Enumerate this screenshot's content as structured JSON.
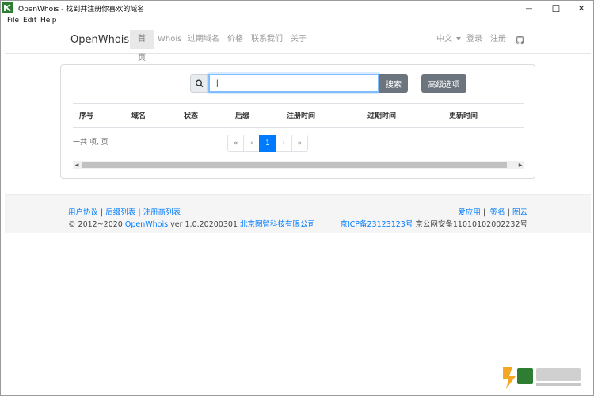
{
  "window": {
    "title": "OpenWhois - 找到并注册你喜欢的域名",
    "minimize_glyph": "—",
    "maximize_glyph": "☐",
    "close_glyph": "✕"
  },
  "menu": [
    "File",
    "Edit",
    "Help"
  ],
  "navbar": {
    "brand": "OpenWhois",
    "links": [
      "首页",
      "Whois",
      "过期域名",
      "价格",
      "联系我们",
      "关于"
    ],
    "active_index": 0,
    "lang": "中文",
    "login": "登录",
    "register": "注册",
    "github_icon": "github-icon"
  },
  "search": {
    "value": "|",
    "placeholder": "",
    "search_label": "搜索",
    "advanced_label": "高级选项"
  },
  "table": {
    "headers": [
      "序号",
      "域名",
      "状态",
      "后缀",
      "注册时间",
      "过期时间",
      "更新时间"
    ],
    "rows": []
  },
  "summary": "一共 项, 页",
  "pager": {
    "first": "«",
    "prev": "‹",
    "current": "1",
    "next": "›",
    "last": "»"
  },
  "footer": {
    "left_links": [
      "用户协议",
      "后缀列表",
      "注册商列表"
    ],
    "separator": "|",
    "copyright": "© 2012~2020",
    "product": "OpenWhois",
    "version": "ver 1.0.20200301",
    "company": "北京图智科技有限公司",
    "right_links": [
      "爱应用",
      "i签名",
      "图云"
    ],
    "icp": "京ICP备23123123号",
    "police": "京公网安备11010102002232号"
  },
  "colors": {
    "accent": "#007bff",
    "button_gray": "#6c757d",
    "footer_bg": "#f5f5f5"
  }
}
